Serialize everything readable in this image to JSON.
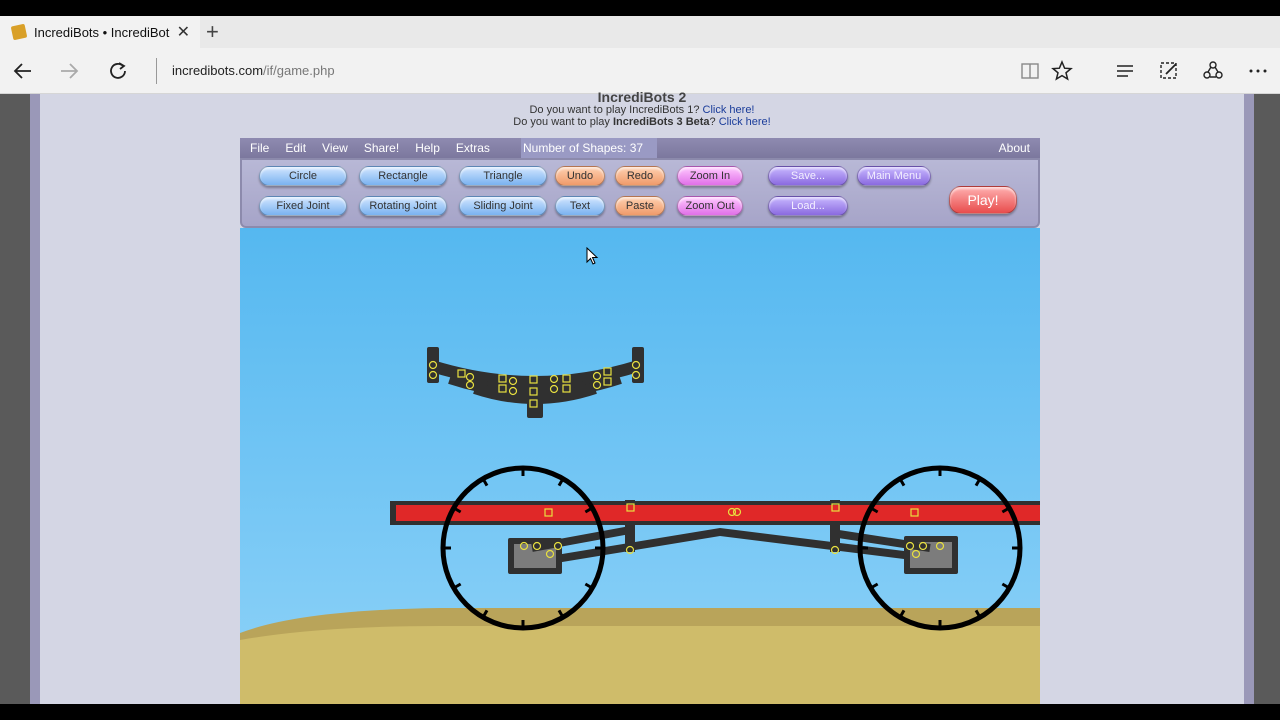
{
  "browser": {
    "tab": {
      "title": "IncrediBots • IncrediBot",
      "favicon": "incredibots-favicon-icon"
    },
    "address": {
      "host": "incredibots.com",
      "path": "/if/game.php"
    },
    "buttons": [
      "back-icon",
      "forward-icon",
      "refresh-icon",
      "reading-view-icon",
      "favorite-star-icon",
      "hub-icon",
      "web-note-icon",
      "share-icon",
      "more-icon"
    ]
  },
  "page": {
    "title": "IncrediBots 2",
    "line1": {
      "text": "Do you want to play IncrediBots 1? ",
      "link": "Click here!"
    },
    "line2": {
      "pre": "Do you want to play ",
      "bold": "IncrediBots 3 Beta",
      "post": "? ",
      "link": "Click here!"
    }
  },
  "game": {
    "menu": [
      "File",
      "Edit",
      "View",
      "Share!",
      "Help",
      "Extras"
    ],
    "shape_count_label": "Number of Shapes:",
    "shape_count": "37",
    "about": "About",
    "buttons": {
      "circle": "Circle",
      "rectangle": "Rectangle",
      "triangle": "Triangle",
      "undo": "Undo",
      "redo": "Redo",
      "zoom_in": "Zoom In",
      "save": "Save...",
      "main_menu": "Main Menu",
      "fixed_joint": "Fixed Joint",
      "rotating_joint": "Rotating Joint",
      "sliding_joint": "Sliding Joint",
      "text": "Text",
      "paste": "Paste",
      "zoom_out": "Zoom Out",
      "load": "Load...",
      "play": "Play!"
    },
    "colors": {
      "sky_top": "#55b8f0",
      "sky_bottom": "#8ed2f8",
      "ground": "#cfbc6a",
      "ground_dark": "#b9a45a",
      "chassis": "#e02828",
      "part": "#303030",
      "joint": "#e8e040"
    }
  }
}
